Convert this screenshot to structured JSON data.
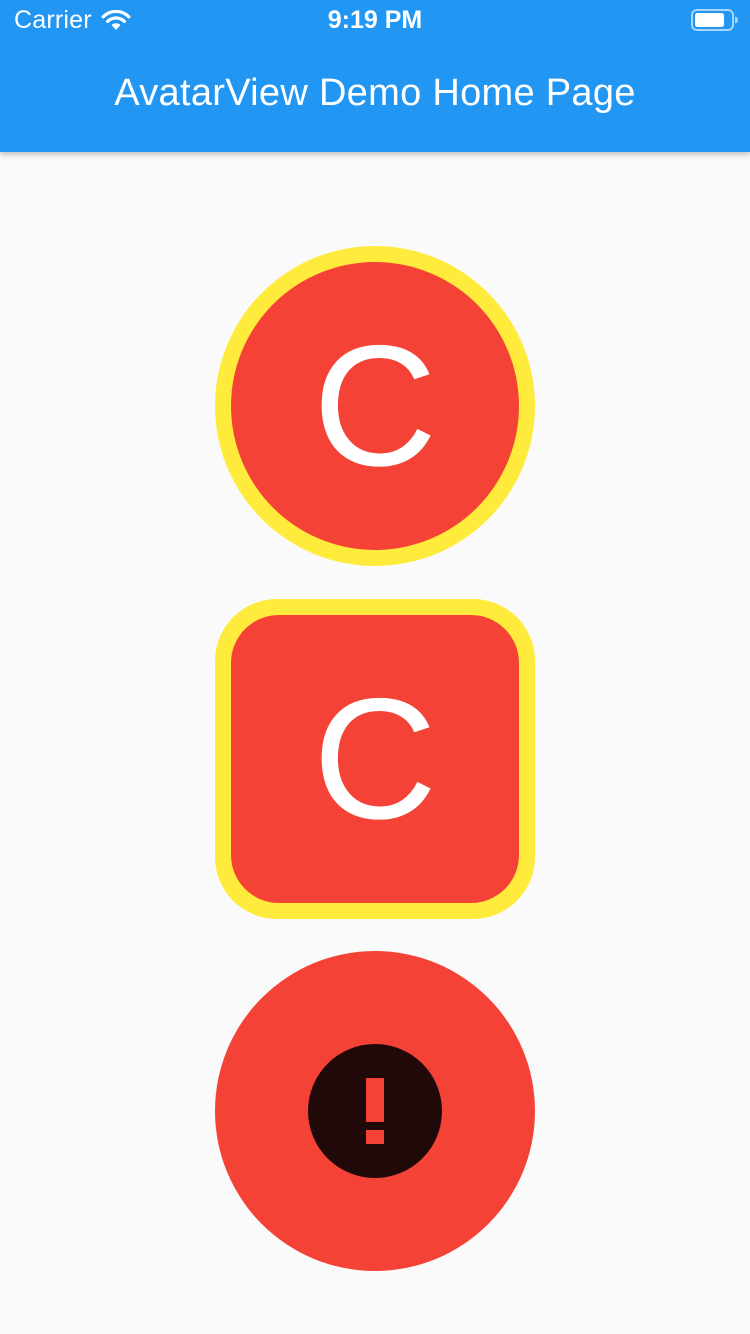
{
  "status_bar": {
    "carrier": "Carrier",
    "time": "9:19 PM",
    "wifi_icon": "wifi-icon",
    "battery_icon": "battery-icon"
  },
  "app_bar": {
    "title": "AvatarView Demo Home Page",
    "color": "#2196f3"
  },
  "avatars": [
    {
      "shape": "circle",
      "initial": "C",
      "background": "#f44336",
      "border_color": "#ffeb3b"
    },
    {
      "shape": "rounded-square",
      "initial": "C",
      "background": "#f44336",
      "border_color": "#ffeb3b"
    },
    {
      "shape": "circle",
      "icon": "error-icon",
      "background": "#f44336",
      "icon_color": "#220909"
    }
  ]
}
